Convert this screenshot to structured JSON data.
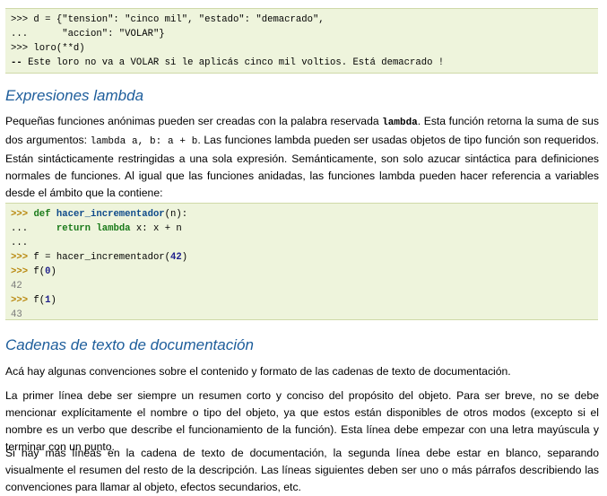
{
  "block1": {
    "l1_prompt": ">>>",
    "l1_code": " d = {\"tension\": \"cinco mil\", \"estado\": \"demacrado\",",
    "l2_prompt": "...",
    "l2_code": "      \"accion\": \"VOLAR\"}",
    "l3_prompt": ">>>",
    "l3_code": " loro(**d)",
    "l4_prompt": "--",
    "l4_code": " Este loro no va a VOLAR si le aplicás cinco mil voltios. Está demacrado !"
  },
  "section1": {
    "heading": "Expresiones lambda",
    "p1_a": "Pequeñas funciones anónimas pueden ser creadas con la palabra reservada ",
    "p1_kw": "lambda",
    "p1_b": ". Esta función retorna la suma de sus dos argumentos: ",
    "p1_code": "lambda a, b: a + b",
    "p1_c": ". Las funciones lambda pueden ser usadas objetos de tipo función son requeridos. Están sintácticamente restringidas a una sola expresión. Semánticamente, son solo azucar sintáctica para definiciones normales de funciones. Al igual que las funciones anidadas, las funciones lambda pueden hacer referencia a variables desde el ámbito que la contiene:"
  },
  "block2": {
    "p": ">>>",
    "dots": "...",
    "def": "def",
    "fname": "hacer_incrementador",
    "args": "(n):",
    "ret_pad": "    ",
    "return": "return",
    "lambda": "lambda",
    "lam_body": " x: x + n",
    "f_assign": " f = hacer_incrementador(",
    "arg42": "42",
    "close": ")",
    "f_call": " f(",
    "arg0": "0",
    "arg1": "1",
    "out1": "42",
    "out2": "43"
  },
  "section2": {
    "heading": "Cadenas de texto de documentación",
    "p1": "Acá hay algunas convenciones sobre el contenido y formato de las cadenas de texto de documentación.",
    "p2": "La primer línea debe ser siempre un resumen corto y conciso del propósito del objeto. Para ser breve, no se debe mencionar explícitamente el nombre o tipo del objeto, ya que estos están disponibles de otros modos (excepto si el nombre es un verbo que describe el funcionamiento de la función). Esta línea debe empezar con una letra mayúscula y terminar con un punto.",
    "p3": "Si hay más líneas en la cadena de texto de documentación, la segunda línea debe estar en blanco, separando visualmente el resumen del resto de la descripción. Las líneas siguientes deben ser uno o más párrafos describiendo las convenciones para llamar al objeto, efectos secundarios, etc."
  }
}
